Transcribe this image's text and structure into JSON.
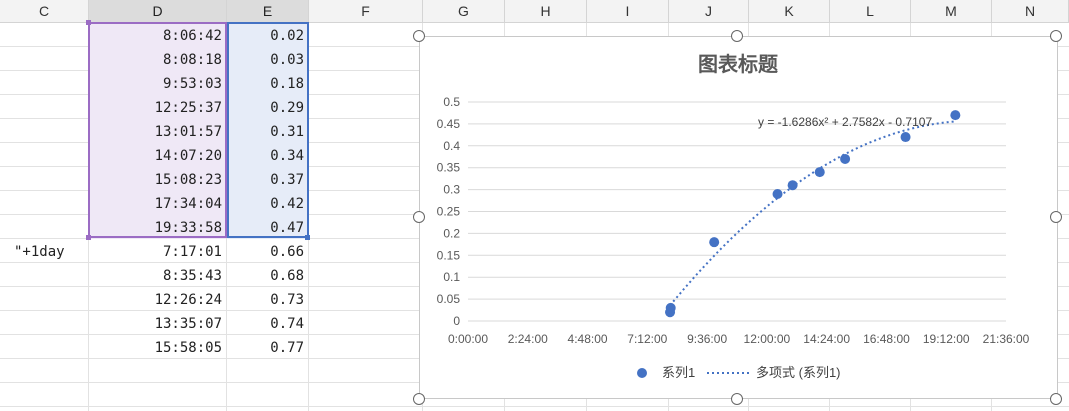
{
  "columns": [
    "C",
    "D",
    "E",
    "F",
    "G",
    "H",
    "I",
    "J",
    "K",
    "L",
    "M",
    "N"
  ],
  "rows": [
    {
      "c": "",
      "d": "8:06:42",
      "e": "0.02"
    },
    {
      "c": "",
      "d": "8:08:18",
      "e": "0.03"
    },
    {
      "c": "",
      "d": "9:53:03",
      "e": "0.18"
    },
    {
      "c": "",
      "d": "12:25:37",
      "e": "0.29"
    },
    {
      "c": "",
      "d": "13:01:57",
      "e": "0.31"
    },
    {
      "c": "",
      "d": "14:07:20",
      "e": "0.34"
    },
    {
      "c": "",
      "d": "15:08:23",
      "e": "0.37"
    },
    {
      "c": "",
      "d": "17:34:04",
      "e": "0.42"
    },
    {
      "c": "",
      "d": "19:33:58",
      "e": "0.47"
    },
    {
      "c": "\"+1day",
      "d": "7:17:01",
      "e": "0.66"
    },
    {
      "c": "",
      "d": "8:35:43",
      "e": "0.68"
    },
    {
      "c": "",
      "d": "12:26:24",
      "e": "0.73"
    },
    {
      "c": "",
      "d": "13:35:07",
      "e": "0.74"
    },
    {
      "c": "",
      "d": "15:58:05",
      "e": "0.77"
    }
  ],
  "colors": {
    "marker": "#4472c4",
    "trendline": "#4472c4",
    "selection_d": "#9b6cc4",
    "selection_e": "#4472c4"
  },
  "chart_data": {
    "type": "scatter",
    "title": "图表标题",
    "x_ticks": [
      "0:00:00",
      "2:24:00",
      "4:48:00",
      "7:12:00",
      "9:36:00",
      "12:00:00",
      "14:24:00",
      "16:48:00",
      "19:12:00",
      "21:36:00"
    ],
    "y_ticks": [
      "0",
      "0.05",
      "0.1",
      "0.15",
      "0.2",
      "0.25",
      "0.3",
      "0.35",
      "0.4",
      "0.45",
      "0.5"
    ],
    "xlim": [
      0,
      0.9
    ],
    "ylim": [
      0,
      0.5
    ],
    "series": [
      {
        "name": "系列1",
        "x": [
          0.33799,
          0.3391,
          0.41184,
          0.51779,
          0.54302,
          0.58843,
          0.63082,
          0.73199,
          0.81526
        ],
        "y": [
          0.02,
          0.03,
          0.18,
          0.29,
          0.31,
          0.34,
          0.37,
          0.42,
          0.47
        ]
      }
    ],
    "trendline": {
      "name": "多项式 (系列1)",
      "coefficients": [
        -1.6286,
        2.7582,
        -0.7107
      ],
      "equation": "y = -1.6286x² + 2.7582x - 0.7107",
      "x_range": [
        0.338,
        0.815
      ]
    },
    "legend_position": "bottom",
    "grid": true
  }
}
